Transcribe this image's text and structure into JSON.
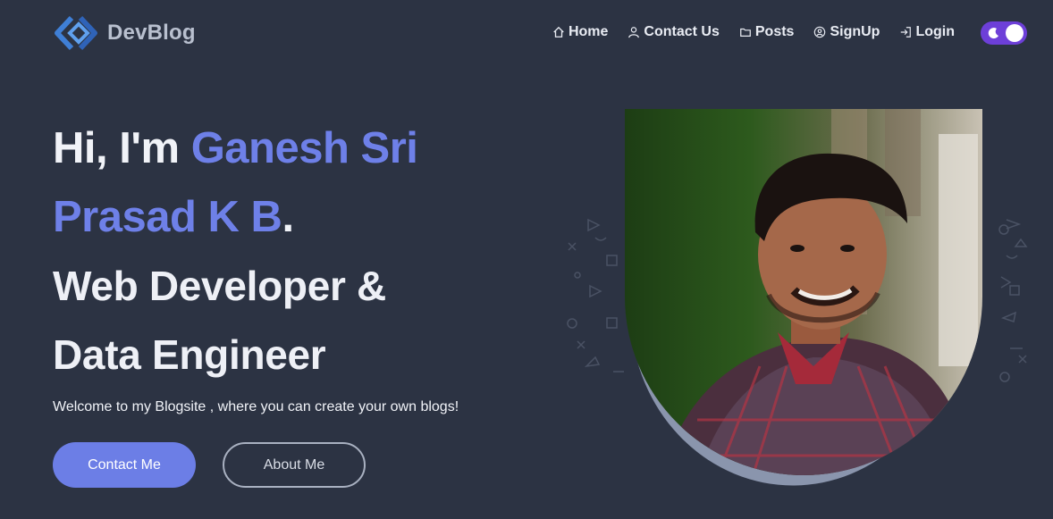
{
  "brand": {
    "name": "DevBlog"
  },
  "nav": {
    "items": [
      {
        "label": "Home",
        "icon": "home-icon"
      },
      {
        "label": "Contact Us",
        "icon": "user-icon"
      },
      {
        "label": "Posts",
        "icon": "folder-icon"
      },
      {
        "label": "SignUp",
        "icon": "user-circle-icon"
      },
      {
        "label": "Login",
        "icon": "login-icon"
      }
    ],
    "theme_toggle": {
      "state": "dark",
      "icon": "moon-icon"
    }
  },
  "hero": {
    "greeting": "Hi, I'm ",
    "name_line1": "Ganesh Sri",
    "name_line2": "Prasad K B",
    "period": ".",
    "role_line1": "Web Developer &",
    "role_line2": "Data Engineer",
    "welcome": "Welcome to my Blogsite , where you can create your own blogs!",
    "primary_button": "Contact Me",
    "secondary_button": "About Me"
  },
  "colors": {
    "background": "#2c3343",
    "accent": "#6e80e8",
    "toggle": "#6d3fd8"
  }
}
